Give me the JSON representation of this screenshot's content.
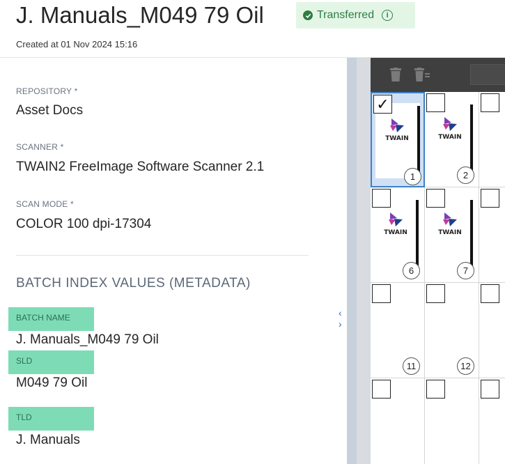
{
  "header": {
    "title": "J. Manuals_M049 79 Oil",
    "status": "Transferred",
    "created": "Created at 01 Nov 2024 15:16"
  },
  "fields": [
    {
      "label": "REPOSITORY *",
      "value": "Asset Docs"
    },
    {
      "label": "SCANNER *",
      "value": "TWAIN2 FreeImage Software Scanner 2.1"
    },
    {
      "label": "SCAN MODE *",
      "value": "COLOR 100 dpi-17304"
    }
  ],
  "metadata": {
    "section_title": "BATCH INDEX VALUES (METADATA)",
    "items": [
      {
        "label": "BATCH NAME",
        "value": "J. Manuals_M049 79 Oil"
      },
      {
        "label": "SLD",
        "value": "M049 79 Oil"
      },
      {
        "label": "TLD",
        "value": "J. Manuals"
      }
    ]
  },
  "splitter": {
    "arrows": "‹ ›"
  },
  "thumbnails": [
    {
      "number": "1",
      "selected": true,
      "checked": true,
      "logo": "TWAIN"
    },
    {
      "number": "2",
      "selected": false,
      "checked": false,
      "logo": "TWAIN"
    },
    {
      "number": "6",
      "selected": false,
      "checked": false,
      "logo": "TWAIN"
    },
    {
      "number": "7",
      "selected": false,
      "checked": false,
      "logo": "TWAIN"
    },
    {
      "number": "11",
      "selected": false,
      "checked": false,
      "logo": ""
    },
    {
      "number": "12",
      "selected": false,
      "checked": false,
      "logo": ""
    }
  ],
  "colors": {
    "badge_bg": "#e3f6e6",
    "badge_text": "#2e7d44",
    "meta_label_bg": "#7ddcb6",
    "selection": "#3b82c4"
  }
}
